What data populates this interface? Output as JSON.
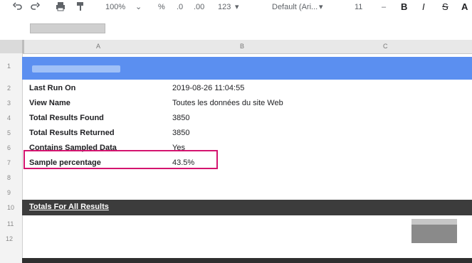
{
  "toolbar": {
    "zoom": "100%",
    "format_buttons": [
      "%",
      ".0",
      ".00",
      "123"
    ],
    "font": "Default (Ari...",
    "font_size": "11",
    "bold": "B",
    "italic": "I",
    "strike": "S",
    "text_color": "A"
  },
  "columns": [
    "A",
    "B",
    "C"
  ],
  "rows": [
    "1",
    "2",
    "3",
    "4",
    "5",
    "6",
    "7",
    "8",
    "9",
    "10",
    "11",
    "12"
  ],
  "report": {
    "fields": [
      {
        "label": "Last Run On",
        "value": "2019-08-26 11:04:55"
      },
      {
        "label": "View Name",
        "value": "Toutes les données du site Web"
      },
      {
        "label": "Total Results Found",
        "value": "3850"
      },
      {
        "label": "Total Results Returned",
        "value": "3850"
      },
      {
        "label": "Contains Sampled Data",
        "value": "Yes"
      },
      {
        "label": "Sample percentage",
        "value": "43.5%"
      }
    ],
    "totals_header": "Totals For All Results"
  },
  "colors": {
    "header_band": "#5b8ff0",
    "totals_band": "#3c3c3c",
    "highlight": "#d4146f"
  }
}
